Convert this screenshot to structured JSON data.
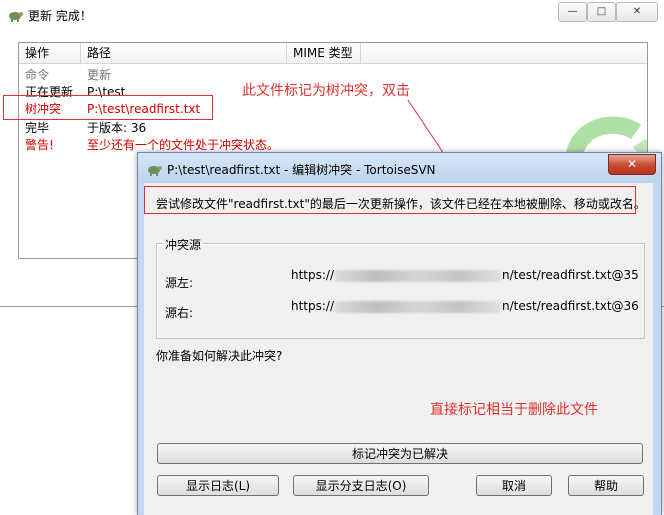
{
  "update_window": {
    "title": "更新 完成！",
    "controls": {
      "minimize": "—",
      "maximize": "□",
      "close": "✕"
    },
    "columns": [
      "操作",
      "路径",
      "MIME 类型"
    ],
    "rows": [
      {
        "action": "命令",
        "path": "更新",
        "style": "gray"
      },
      {
        "action": "正在更新",
        "path": "P:\\test",
        "style": "normal"
      },
      {
        "action": "树冲突",
        "path": "P:\\test\\readfirst.txt",
        "style": "red"
      },
      {
        "action": "完毕",
        "path": "于版本: 36",
        "style": "normal"
      },
      {
        "action": "警告!",
        "path": "至少还有一个的文件处于冲突状态。",
        "style": "red"
      }
    ]
  },
  "annotations": {
    "tree_conflict_note": "此文件标记为树冲突，双击",
    "mark_resolved_note": "直接标记相当于删除此文件"
  },
  "conflict_dialog": {
    "title": "P:\\test\\readfirst.txt - 编辑树冲突 - TortoiseSVN",
    "close": "✕",
    "description": "尝试修改文件\"readfirst.txt\"的最后一次更新操作，该文件已经在本地被删除、移动或改名。",
    "group_label": "冲突源",
    "source_left": {
      "label": "源左:",
      "prefix": "https://",
      "suffix": "n/test/readfirst.txt@35"
    },
    "source_right": {
      "label": "源右:",
      "prefix": "https://",
      "suffix": "n/test/readfirst.txt@36"
    },
    "question": "你准备如何解决此冲突?",
    "buttons": {
      "mark_resolved": "标记冲突为已解决",
      "show_log": "显示日志(L)",
      "show_branch_log": "显示分支日志(O)",
      "cancel": "取消",
      "help": "帮助"
    }
  },
  "colors": {
    "annotation": "#e23030",
    "conflict_text": "#d20000",
    "logo_green": "#5fbf50"
  }
}
